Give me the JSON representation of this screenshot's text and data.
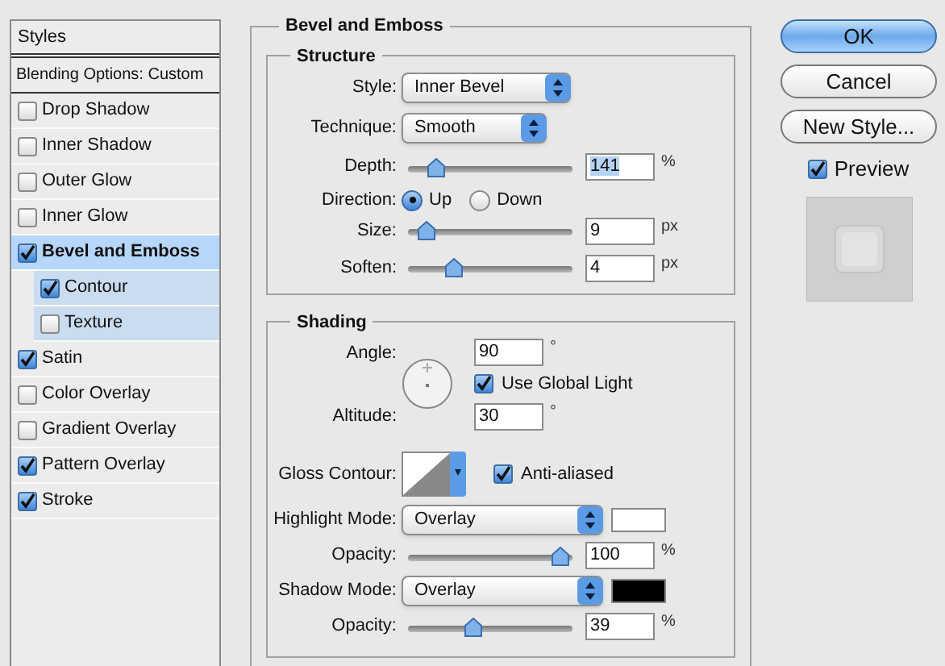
{
  "styles_panel": {
    "header": "Styles",
    "blending": "Blending Options: Custom",
    "items": [
      {
        "label": "Drop Shadow",
        "checked": false,
        "selected": false
      },
      {
        "label": "Inner Shadow",
        "checked": false,
        "selected": false
      },
      {
        "label": "Outer Glow",
        "checked": false,
        "selected": false
      },
      {
        "label": "Inner Glow",
        "checked": false,
        "selected": false
      },
      {
        "label": "Bevel and Emboss",
        "checked": true,
        "selected": true,
        "children": [
          {
            "label": "Contour",
            "checked": true,
            "selected": false
          },
          {
            "label": "Texture",
            "checked": false,
            "selected": false
          }
        ]
      },
      {
        "label": "Satin",
        "checked": true,
        "selected": false
      },
      {
        "label": "Color Overlay",
        "checked": false,
        "selected": false
      },
      {
        "label": "Gradient Overlay",
        "checked": false,
        "selected": false
      },
      {
        "label": "Pattern Overlay",
        "checked": true,
        "selected": false
      },
      {
        "label": "Stroke",
        "checked": true,
        "selected": false
      }
    ]
  },
  "effect": {
    "title": "Bevel and Emboss",
    "structure": {
      "title": "Structure",
      "style": {
        "label": "Style:",
        "value": "Inner Bevel"
      },
      "technique": {
        "label": "Technique:",
        "value": "Smooth"
      },
      "depth": {
        "label": "Depth:",
        "level": 0.13,
        "value": "141",
        "unit": "%"
      },
      "direction": {
        "label": "Direction:",
        "options": [
          {
            "label": "Up",
            "selected": true
          },
          {
            "label": "Down",
            "selected": false
          }
        ]
      },
      "size": {
        "label": "Size:",
        "level": 0.07,
        "value": "9",
        "unit": "px"
      },
      "soften": {
        "label": "Soften:",
        "level": 0.25,
        "value": "4",
        "unit": "px"
      }
    },
    "shading": {
      "title": "Shading",
      "angle": {
        "label": "Angle:",
        "value": "90",
        "unit": "°"
      },
      "use_global_light": {
        "label": "Use Global Light",
        "checked": true
      },
      "altitude": {
        "label": "Altitude:",
        "value": "30",
        "unit": "°"
      },
      "gloss_contour": {
        "label": "Gloss Contour:"
      },
      "anti_aliased": {
        "label": "Anti-aliased",
        "checked": true
      },
      "highlight_mode": {
        "label": "Highlight Mode:",
        "value": "Overlay",
        "color": "#ffffff"
      },
      "highlight_opacity": {
        "label": "Opacity:",
        "level": 0.98,
        "value": "100",
        "unit": "%"
      },
      "shadow_mode": {
        "label": "Shadow Mode:",
        "value": "Overlay",
        "color": "#000000"
      },
      "shadow_opacity": {
        "label": "Opacity:",
        "level": 0.39,
        "value": "39",
        "unit": "%"
      }
    }
  },
  "buttons": [
    {
      "label": "OK",
      "kind": "default"
    },
    {
      "label": "Cancel",
      "kind": "normal"
    },
    {
      "label": "New Style...",
      "kind": "normal"
    }
  ],
  "preview": {
    "label": "Preview",
    "checked": true
  }
}
